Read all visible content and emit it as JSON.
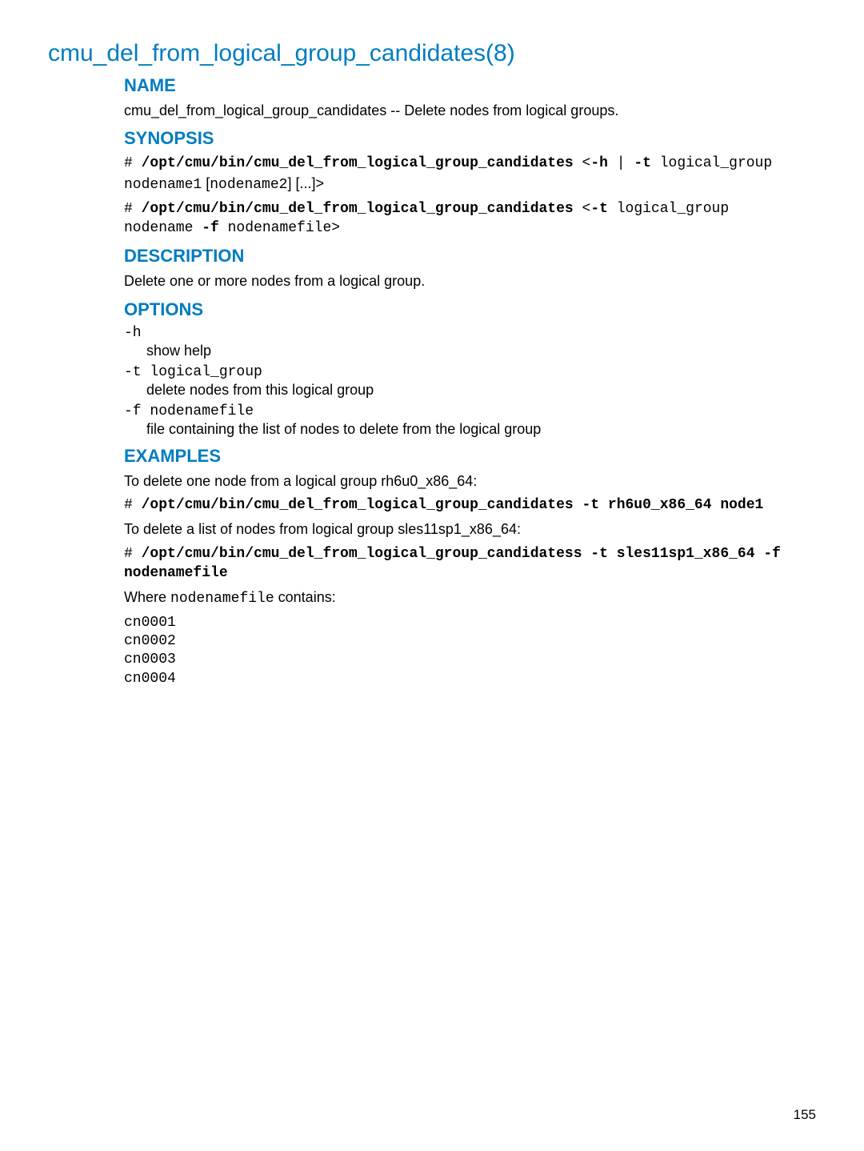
{
  "title": "cmu_del_from_logical_group_candidates(8)",
  "sections": {
    "name": {
      "heading": "NAME",
      "text": "cmu_del_from_logical_group_candidates -- Delete nodes from logical groups."
    },
    "synopsis": {
      "heading": "SYNOPSIS",
      "line1": {
        "hash": "# ",
        "cmd": "/opt/cmu/bin/cmu_del_from_logical_group_candidates",
        "sep1": " <",
        "flag_h": "-h",
        "bar": " | ",
        "flag_t": "-t",
        "arg_t": " logical_group",
        "line2a": "nodename1",
        "brk": " [",
        "line2b": "nodename2",
        "brk2": "] [...]>"
      },
      "line2": {
        "hash": "# ",
        "cmd": "/opt/cmu/bin/cmu_del_from_logical_group_candidates",
        "sep1": " <",
        "flag_t": "-t",
        "arg_t": " logical_group",
        "line2a": "nodename ",
        "flag_f": "-f",
        "arg_f": " nodenamefile>"
      }
    },
    "description": {
      "heading": "DESCRIPTION",
      "text": "Delete one or more nodes from a logical group."
    },
    "options": {
      "heading": "OPTIONS",
      "items": [
        {
          "flag": "-h",
          "desc": "show help"
        },
        {
          "flag": "-t logical_group",
          "desc": "delete nodes from this logical group"
        },
        {
          "flag": "-f nodenamefile",
          "desc": "file containing the list of nodes to delete from the logical group"
        }
      ]
    },
    "examples": {
      "heading": "EXAMPLES",
      "intro1": "To delete one node from a logical group rh6u0_x86_64:",
      "cmd1": {
        "hash": "# ",
        "cmd": "/opt/cmu/bin/cmu_del_from_logical_group_candidates -t rh6u0_x86_64 node1"
      },
      "intro2": "To delete a list of nodes from logical group sles11sp1_x86_64:",
      "cmd2": {
        "hash": "# ",
        "cmd": "/opt/cmu/bin/cmu_del_from_logical_group_candidatess -t sles11sp1_x86_64 -f nodenamefile"
      },
      "where_pre": "Where ",
      "where_code": "nodenamefile",
      "where_post": " contains:",
      "filecontents": "cn0001\ncn0002\ncn0003\ncn0004"
    }
  },
  "pagenum": "155"
}
